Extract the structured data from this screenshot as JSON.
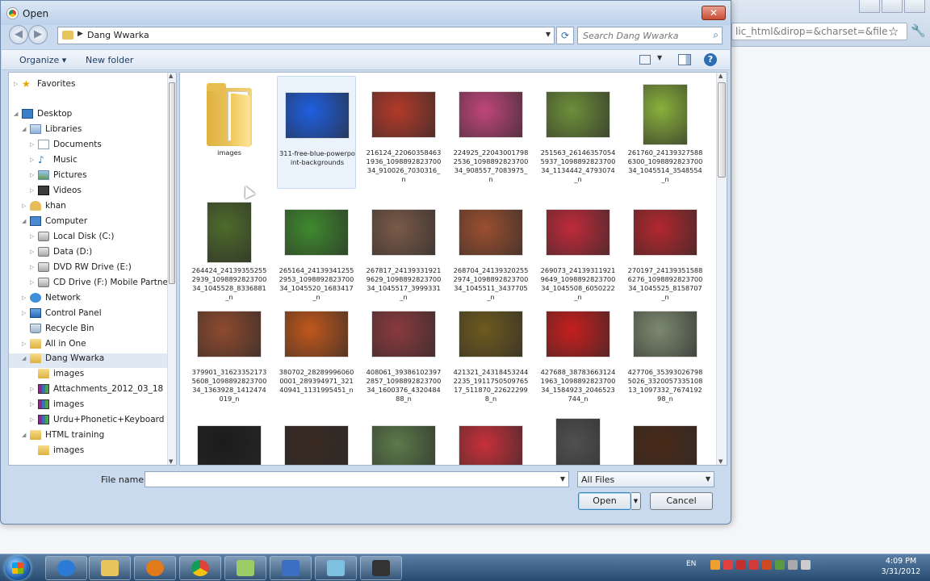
{
  "browser": {
    "url_fragment": "lic_html&dirop=&charset=&file"
  },
  "dialog": {
    "title": "Open",
    "close_glyph": "✕",
    "address": {
      "current": "Dang Wwarka"
    },
    "search": {
      "placeholder": "Search Dang Wwarka"
    },
    "toolbar": {
      "organize": "Organize ▾",
      "new_folder": "New folder",
      "help": "?"
    }
  },
  "nav_tree": [
    {
      "label": "Favorites",
      "icon": "star-icon",
      "indent": 0,
      "toggle": "▷"
    },
    {
      "label": "Desktop",
      "icon": "desktop-icon",
      "indent": 0,
      "toggle": "◢"
    },
    {
      "label": "Libraries",
      "icon": "libraries-icon",
      "indent": 1,
      "toggle": "◢"
    },
    {
      "label": "Documents",
      "icon": "document-icon",
      "indent": 2,
      "toggle": "▷"
    },
    {
      "label": "Music",
      "icon": "music-icon",
      "indent": 2,
      "toggle": "▷"
    },
    {
      "label": "Pictures",
      "icon": "pictures-icon",
      "indent": 2,
      "toggle": "▷"
    },
    {
      "label": "Videos",
      "icon": "videos-icon",
      "indent": 2,
      "toggle": "▷"
    },
    {
      "label": "khan",
      "icon": "user-icon",
      "indent": 1,
      "toggle": "▷"
    },
    {
      "label": "Computer",
      "icon": "computer-icon",
      "indent": 1,
      "toggle": "◢"
    },
    {
      "label": "Local Disk (C:)",
      "icon": "disk-icon",
      "indent": 2,
      "toggle": "▷"
    },
    {
      "label": "Data (D:)",
      "icon": "disk-icon",
      "indent": 2,
      "toggle": "▷"
    },
    {
      "label": "DVD RW Drive (E:)",
      "icon": "disk-icon",
      "indent": 2,
      "toggle": "▷"
    },
    {
      "label": "CD Drive (F:) Mobile Partner",
      "icon": "disk-icon",
      "indent": 2,
      "toggle": "▷"
    },
    {
      "label": "Network",
      "icon": "network-icon",
      "indent": 1,
      "toggle": "▷"
    },
    {
      "label": "Control Panel",
      "icon": "control-panel-icon",
      "indent": 1,
      "toggle": "▷"
    },
    {
      "label": "Recycle Bin",
      "icon": "recycle-bin-icon",
      "indent": 1,
      "toggle": ""
    },
    {
      "label": "All in One",
      "icon": "folder-icon",
      "indent": 1,
      "toggle": "▷"
    },
    {
      "label": "Dang Wwarka",
      "icon": "folder-icon",
      "indent": 1,
      "toggle": "◢",
      "selected": true
    },
    {
      "label": "images",
      "icon": "folder-icon",
      "indent": 2,
      "toggle": ""
    },
    {
      "label": "Attachments_2012_03_18",
      "icon": "archive-icon",
      "indent": 2,
      "toggle": "▷"
    },
    {
      "label": "images",
      "icon": "archive-icon",
      "indent": 2,
      "toggle": "▷"
    },
    {
      "label": "Urdu+Phonetic+Keyboard",
      "icon": "archive-icon",
      "indent": 2,
      "toggle": "▷"
    },
    {
      "label": "HTML training",
      "icon": "folder-icon",
      "indent": 1,
      "toggle": "◢"
    },
    {
      "label": "images",
      "icon": "folder-icon",
      "indent": 2,
      "toggle": ""
    }
  ],
  "files": [
    {
      "label": "images",
      "kind": "folder",
      "color": "#e6bd4e"
    },
    {
      "label": "311-free-blue-powerpoint-backgrounds",
      "kind": "image",
      "color": "#1f5fe0",
      "selected": true
    },
    {
      "label": "216124_220603584631936_109889282370034_910026_7030316_n",
      "kind": "image",
      "color": "#b33a2a"
    },
    {
      "label": "224925_220430017982536_109889282370034_908557_7083975_n",
      "kind": "image",
      "color": "#c0467a"
    },
    {
      "label": "251563_261463570545937_109889282370034_1134442_4793074_n",
      "kind": "image",
      "color": "#6e8f3a"
    },
    {
      "label": "261760_241393275886300_109889282370034_1045514_3548554_n",
      "kind": "image",
      "color": "#8ab13c"
    },
    {
      "label": "264424_241393552552939_109889282370034_1045528_8336881_n",
      "kind": "image",
      "color": "#4e6b2a"
    },
    {
      "label": "265164_241393412552953_109889282370034_1045520_1683417_n",
      "kind": "image",
      "color": "#3f8a2e"
    },
    {
      "label": "267817_241393319219629_109889282370034_1045517_3999331_n",
      "kind": "image",
      "color": "#7a5a48"
    },
    {
      "label": "268704_241393202552974_109889282370034_1045511_3437705_n",
      "kind": "image",
      "color": "#9b4f2f"
    },
    {
      "label": "269073_241393119219649_109889282370034_1045508_6050222_n",
      "kind": "image",
      "color": "#c02a3a"
    },
    {
      "label": "270197_241393515886276_109889282370034_1045525_8158707_n",
      "kind": "image",
      "color": "#b3272e"
    },
    {
      "label": "379901_316233521735608_109889282370034_1363928_1412474019_n",
      "kind": "image",
      "color": "#8e4a2e"
    },
    {
      "label": "380702_282899960600001_289394971_32140941_1131995451_n",
      "kind": "image",
      "color": "#c0571c"
    },
    {
      "label": "408061_393861023972857_109889282370034_1600376_432048488_n",
      "kind": "image",
      "color": "#8a3a3e"
    },
    {
      "label": "421321_243184532442235_191175050976517_511870_226222998_n",
      "kind": "image",
      "color": "#6e5a1e"
    },
    {
      "label": "427688_387836631241963_109889282370034_1584923_2046523744_n",
      "kind": "image",
      "color": "#c71e1e"
    },
    {
      "label": "427706_353930267985026_332005733510813_1097332_767419298_n",
      "kind": "image",
      "color": "#7c8a70"
    },
    {
      "label": "",
      "kind": "image",
      "color": "#1b1b1b"
    },
    {
      "label": "",
      "kind": "image",
      "color": "#3a2a22"
    },
    {
      "label": "",
      "kind": "image",
      "color": "#5c7a4a"
    },
    {
      "label": "",
      "kind": "image",
      "color": "#c8303a"
    },
    {
      "label": "",
      "kind": "image",
      "color": "#505050"
    },
    {
      "label": "",
      "kind": "image",
      "color": "#4a2a18"
    }
  ],
  "bottom": {
    "file_name_label": "File name:",
    "file_name_value": "",
    "file_type": "All Files",
    "open_label": "Open",
    "cancel_label": "Cancel"
  },
  "taskbar": {
    "apps": [
      "internet-explorer-icon",
      "explorer-icon",
      "media-player-icon",
      "chrome-icon",
      "notepad-icon",
      "word-icon",
      "paint-icon",
      "camtasia-icon"
    ],
    "language": "EN",
    "time": "4:09 PM",
    "date": "3/31/2012"
  },
  "colors": {
    "titlebar": "#c9daef",
    "selection": "#dfe8f3",
    "taskbar": "#274a70"
  }
}
